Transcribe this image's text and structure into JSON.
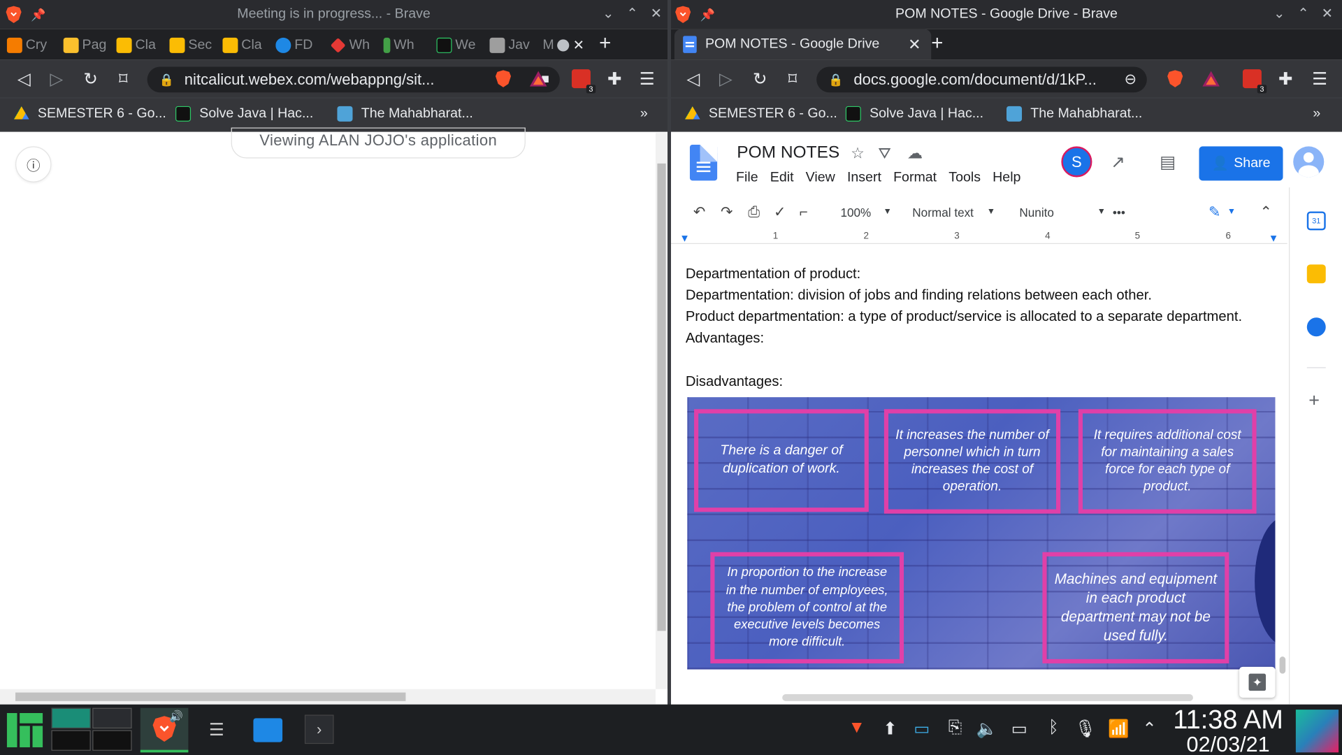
{
  "left_window": {
    "title": "Meeting is in progress... - Brave",
    "tabs": [
      "Cry",
      "Pag",
      "Cla",
      "Sec",
      "Cla",
      "FD",
      "Wh",
      "Wh",
      "We",
      "Jav",
      "M"
    ],
    "url": "nitcalicut.webex.com/webappng/sit...",
    "bookmarks": [
      "SEMESTER 6 - Go...",
      "Solve Java | Hac...",
      "The Mahabharat..."
    ],
    "banner": "Viewing ALAN JOJO's application",
    "ext_badge": "3"
  },
  "right_window": {
    "title": "POM NOTES - Google Drive - Brave",
    "tab_label": "POM NOTES - Google Drive",
    "url": "docs.google.com/document/d/1kP...",
    "bookmarks": [
      "SEMESTER 6 - Go...",
      "Solve Java | Hac...",
      "The Mahabharat..."
    ],
    "ext_badge": "3"
  },
  "docs": {
    "title": "POM NOTES",
    "menu": [
      "File",
      "Edit",
      "View",
      "Insert",
      "Format",
      "Tools",
      "Help"
    ],
    "avatar_letter": "S",
    "share_label": "Share",
    "zoom": "100%",
    "style": "Normal text",
    "font": "Nunito",
    "ruler": [
      "1",
      "2",
      "3",
      "4",
      "5",
      "6"
    ],
    "lines": [
      "Departmentation of product:",
      "Departmentation: division of jobs and finding relations between each other.",
      "Product departmentation: a type of product/service is allocated to a separate department.",
      "Advantages:",
      "Disadvantages:"
    ],
    "image_boxes": [
      "There is a danger of duplication of work.",
      "It increases the number of personnel which in turn increases the cost of operation.",
      "It requires additional cost for maintaining a sales force for each type of product.",
      "In proportion to the increase in the number of employees, the problem of control at the executive levels becomes more difficult.",
      "Machines and equipment in each product department may not be used fully."
    ]
  },
  "taskbar": {
    "time": "11:38 AM",
    "date": "02/03/21"
  },
  "colors": {
    "accent": "#1a73e8",
    "box_border": "#e040a8",
    "taskbar": "#1d1f22"
  }
}
